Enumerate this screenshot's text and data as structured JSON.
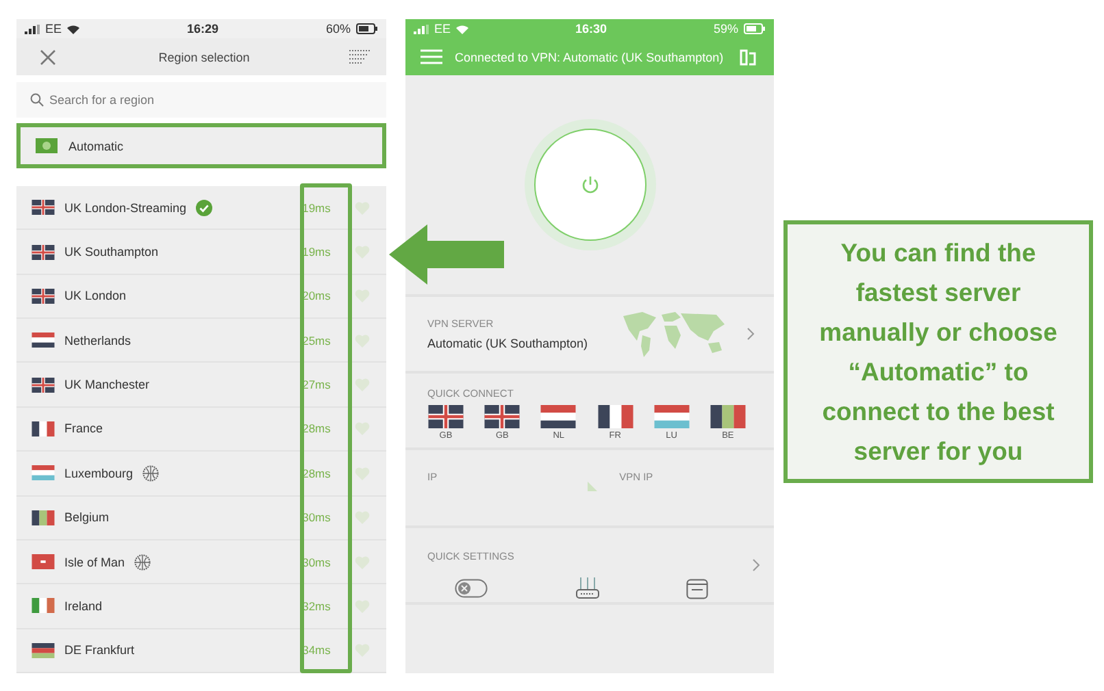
{
  "left_phone": {
    "status_bar": {
      "carrier": "EE",
      "time": "16:29",
      "battery": "60%"
    },
    "header": {
      "title": "Region selection"
    },
    "search": {
      "placeholder": "Search for a region"
    },
    "automatic": {
      "label": "Automatic",
      "highlighted": true
    },
    "regions": [
      {
        "name": "UK London-Streaming",
        "flag": {
          "kind": "unionjack"
        },
        "badge": {
          "kind": "check"
        },
        "latency": "19ms"
      },
      {
        "name": "UK Southampton",
        "flag": {
          "kind": "unionjack"
        },
        "latency": "19ms"
      },
      {
        "name": "UK London",
        "flag": {
          "kind": "unionjack"
        },
        "latency": "20ms"
      },
      {
        "name": "Netherlands",
        "flag": {
          "kind": "dutch"
        },
        "latency": "25ms"
      },
      {
        "name": "UK Manchester",
        "flag": {
          "kind": "unionjack"
        },
        "latency": "27ms"
      },
      {
        "name": "France",
        "flag": {
          "kind": "french"
        },
        "latency": "28ms"
      },
      {
        "name": "Luxembourg",
        "flag": {
          "kind": "luxembourgish"
        },
        "badge": {
          "kind": "globe"
        },
        "latency": "28ms"
      },
      {
        "name": "Belgium",
        "flag": {
          "kind": "belgian"
        },
        "latency": "30ms"
      },
      {
        "name": "Isle of Man",
        "flag": {
          "kind": "manx"
        },
        "badge": {
          "kind": "globe"
        },
        "latency": "30ms"
      },
      {
        "name": "Ireland",
        "flag": {
          "kind": "irish"
        },
        "latency": "32ms"
      },
      {
        "name": "DE Frankfurt",
        "flag": {
          "kind": "german"
        },
        "latency": "34ms"
      }
    ]
  },
  "right_phone": {
    "status_bar": {
      "carrier": "EE",
      "time": "16:30",
      "battery": "59%"
    },
    "header": {
      "title": "Connected to VPN: Automatic (UK Southampton)"
    },
    "vpn_server": {
      "label": "VPN SERVER",
      "value": "Automatic (UK Southampton)"
    },
    "quick_connect": {
      "label": "QUICK CONNECT",
      "flags": [
        {
          "code": "GB",
          "flag": {
            "kind": "unionjack"
          }
        },
        {
          "code": "GB",
          "flag": {
            "kind": "unionjack"
          }
        },
        {
          "code": "NL",
          "flag": {
            "kind": "dutch"
          }
        },
        {
          "code": "FR",
          "flag": {
            "kind": "french"
          }
        },
        {
          "code": "LU",
          "flag": {
            "kind": "luxembourgish"
          }
        },
        {
          "code": "BE",
          "flag": {
            "kind": "belgian"
          }
        }
      ]
    },
    "ip": {
      "label": "IP",
      "vpn_label": "VPN IP"
    },
    "quick_settings": {
      "label": "QUICK SETTINGS"
    }
  },
  "callout": {
    "text": "You can find the fastest server manually or choose “Automatic” to connect to the best server for you"
  }
}
